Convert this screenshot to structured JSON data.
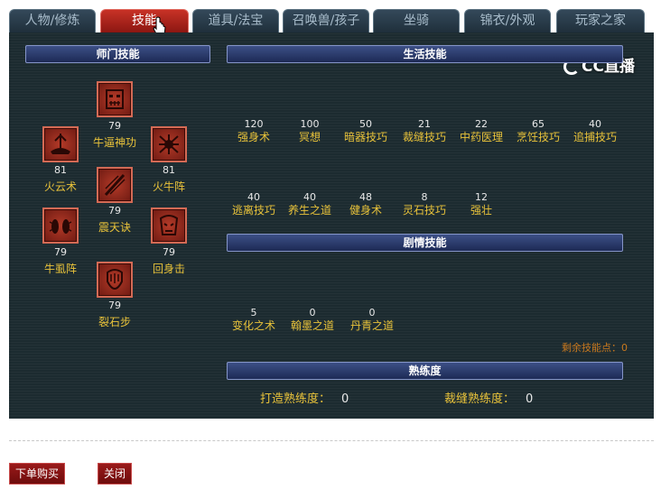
{
  "tabs": [
    {
      "label": "人物/修炼",
      "active": false
    },
    {
      "label": "技能",
      "active": true
    },
    {
      "label": "道具/法宝",
      "active": false
    },
    {
      "label": "召唤兽/孩子",
      "active": false
    },
    {
      "label": "坐骑",
      "active": false
    },
    {
      "label": "锦衣/外观",
      "active": false
    },
    {
      "label": "玩家之家",
      "active": false
    }
  ],
  "watermark": "CC直播",
  "sect": {
    "title": "师门技能",
    "skills": [
      {
        "name": "牛逼神功",
        "level": "79",
        "icon": "demon-face-icon"
      },
      {
        "name": "火云术",
        "level": "81",
        "icon": "flame-cloud-icon"
      },
      {
        "name": "火牛阵",
        "level": "81",
        "icon": "bull-fire-icon"
      },
      {
        "name": "震天诀",
        "level": "79",
        "icon": "slash-icon"
      },
      {
        "name": "牛虱阵",
        "level": "79",
        "icon": "beetle-icon"
      },
      {
        "name": "回身击",
        "level": "79",
        "icon": "mask-icon"
      },
      {
        "name": "裂石步",
        "level": "79",
        "icon": "rock-claw-icon"
      }
    ]
  },
  "life": {
    "title": "生活技能",
    "skills": [
      {
        "name": "强身术",
        "value": "120"
      },
      {
        "name": "冥想",
        "value": "100"
      },
      {
        "name": "暗器技巧",
        "value": "50"
      },
      {
        "name": "裁缝技巧",
        "value": "21"
      },
      {
        "name": "中药医理",
        "value": "22"
      },
      {
        "name": "烹饪技巧",
        "value": "65"
      },
      {
        "name": "追捕技巧",
        "value": "40"
      },
      {
        "name": "逃离技巧",
        "value": "40"
      },
      {
        "name": "养生之道",
        "value": "40"
      },
      {
        "name": "健身术",
        "value": "48"
      },
      {
        "name": "灵石技巧",
        "value": "8"
      },
      {
        "name": "强壮",
        "value": "12"
      }
    ]
  },
  "story": {
    "title": "剧情技能",
    "skills": [
      {
        "name": "变化之术",
        "value": "5"
      },
      {
        "name": "翰墨之道",
        "value": "0"
      },
      {
        "name": "丹青之道",
        "value": "0"
      }
    ]
  },
  "remaining_points": "剩余技能点：0",
  "proficiency": {
    "title": "熟练度",
    "items": [
      {
        "label": "打造熟练度：",
        "value": "0"
      },
      {
        "label": "裁缝熟练度：",
        "value": "0"
      }
    ]
  },
  "buttons": {
    "buy": "下单购买",
    "close": "关闭"
  },
  "colors": {
    "accent_red": "#b8261c",
    "label_gold": "#e8c23a",
    "panel_bg": "#1c2b30",
    "header_blue": "#2c3c70"
  }
}
